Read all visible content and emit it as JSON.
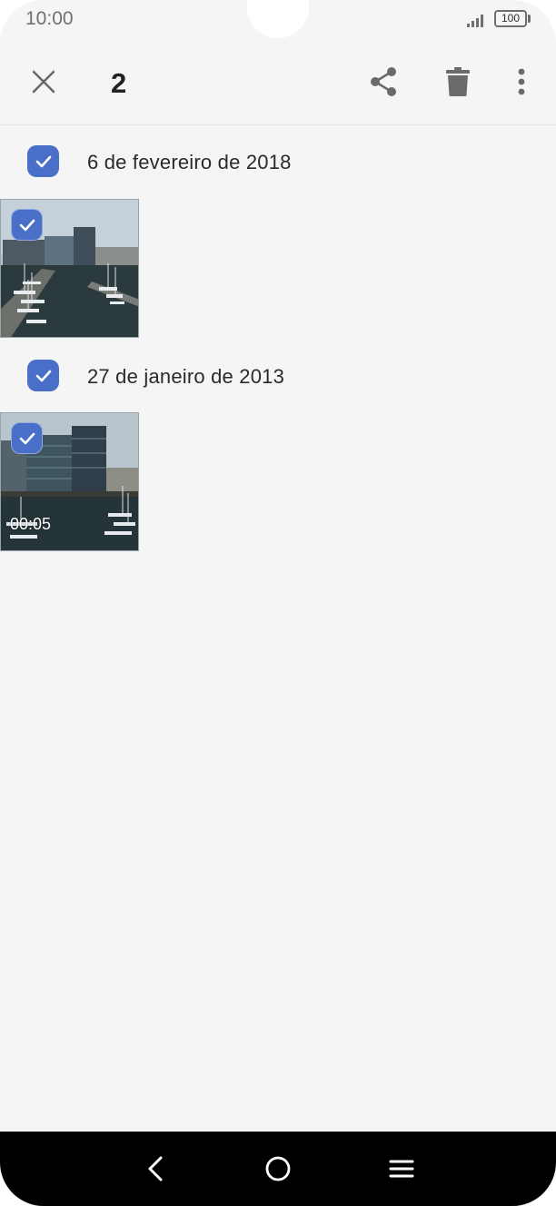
{
  "status_bar": {
    "time": "10:00",
    "battery": "100"
  },
  "action_bar": {
    "selected_count": "2",
    "icons": [
      "close-icon",
      "share-icon",
      "delete-icon",
      "more-vert-icon"
    ]
  },
  "sections": [
    {
      "date_label": "6 de fevereiro de 2018",
      "items": [
        {
          "type": "photo",
          "selected": true
        }
      ]
    },
    {
      "date_label": "27 de janeiro de 2013",
      "items": [
        {
          "type": "video",
          "duration": "00:05",
          "selected": true
        }
      ]
    }
  ],
  "nav_bar": {
    "icons": [
      "back-icon",
      "home-icon",
      "recents-icon"
    ]
  },
  "colors": {
    "accent": "#4a6fc8",
    "background": "#f5f5f5",
    "nav_background": "#000000"
  }
}
